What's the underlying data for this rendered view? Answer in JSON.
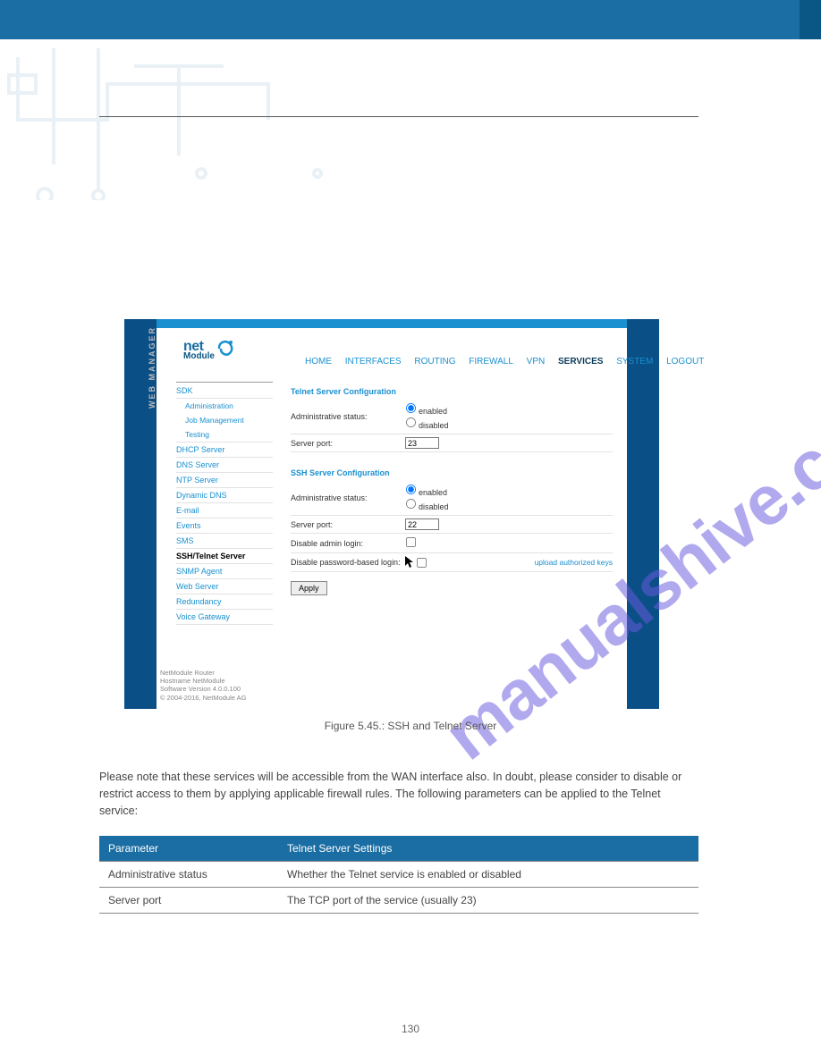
{
  "watermark": "manualshive.com",
  "fig_caption": "Figure 5.45.: SSH and Telnet Server",
  "body_text": "Please note that these services will be accessible from the WAN interface also. In doubt, please consider to disable or restrict access to them by applying applicable firewall rules. The following parameters can be applied to the Telnet service:",
  "param_table": {
    "col1": "Parameter",
    "col2": "Telnet Server Settings",
    "rows": [
      {
        "p": "Administrative status",
        "d": "Whether the Telnet service is enabled or disabled"
      },
      {
        "p": "Server port",
        "d": "The TCP port of the service (usually 23)"
      }
    ]
  },
  "pagenum": "130",
  "screenshot": {
    "logo_main": "net",
    "logo_sub": "Module",
    "web_manager_label": "WEB MANAGER",
    "nav": {
      "items": [
        "HOME",
        "INTERFACES",
        "ROUTING",
        "FIREWALL",
        "VPN",
        "SERVICES",
        "SYSTEM",
        "LOGOUT"
      ],
      "active": "SERVICES"
    },
    "sidebar": {
      "sdk": "SDK",
      "sdk_sub": [
        "Administration",
        "Job Management",
        "Testing"
      ],
      "items": [
        "DHCP Server",
        "DNS Server",
        "NTP Server",
        "Dynamic DNS",
        "E-mail",
        "Events",
        "SMS",
        "SSH/Telnet Server",
        "SNMP Agent",
        "Web Server",
        "Redundancy",
        "Voice Gateway"
      ],
      "active": "SSH/Telnet Server"
    },
    "telnet": {
      "title": "Telnet Server Configuration",
      "admin_label": "Administrative status:",
      "enabled_label": "enabled",
      "disabled_label": "disabled",
      "port_label": "Server port:",
      "port_value": "23"
    },
    "ssh": {
      "title": "SSH Server Configuration",
      "admin_label": "Administrative status:",
      "enabled_label": "enabled",
      "disabled_label": "disabled",
      "port_label": "Server port:",
      "port_value": "22",
      "disable_admin_label": "Disable admin login:",
      "disable_pw_label": "Disable password-based login:",
      "upload_keys": "upload authorized keys"
    },
    "apply": "Apply",
    "footer": {
      "l1": "NetModule Router",
      "l2": "Hostname NetModule",
      "l3": "Software Version 4.0.0.100",
      "l4": "© 2004-2016, NetModule AG"
    }
  }
}
